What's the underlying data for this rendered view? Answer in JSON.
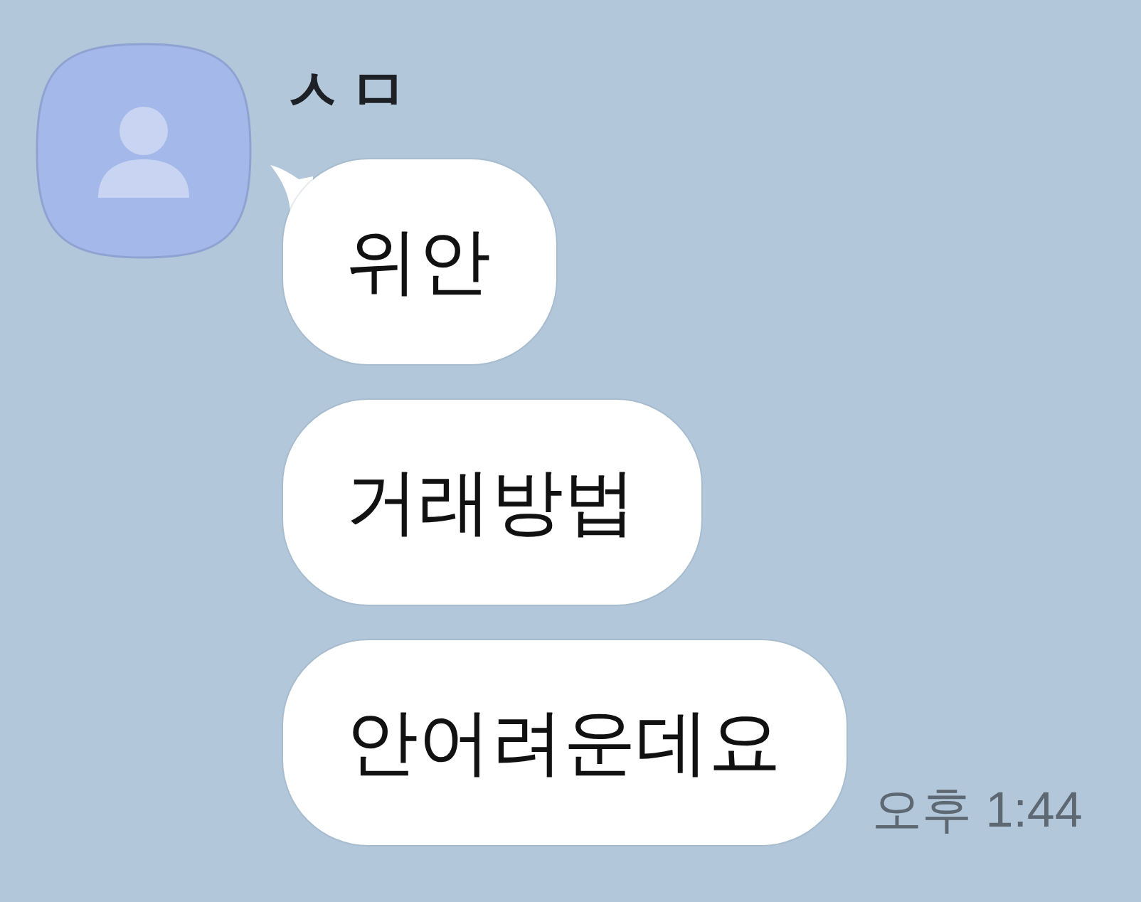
{
  "contact": {
    "name": "ㅅㅁ"
  },
  "messages": [
    {
      "text": "위안",
      "tail": true
    },
    {
      "text": "거래방법",
      "tail": false
    },
    {
      "text": "안어려운데요",
      "tail": false,
      "time": "오후 1:44"
    }
  ]
}
